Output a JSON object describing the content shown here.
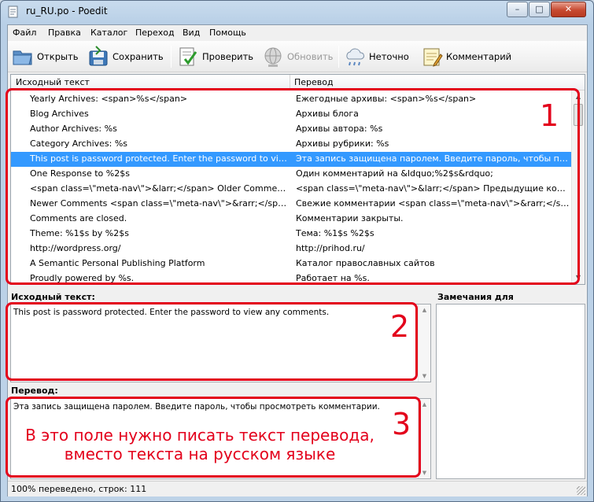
{
  "window": {
    "title": "ru_RU.po - Poedit",
    "minimize_label": "–",
    "maximize_label": "□",
    "close_label": "✕"
  },
  "menu": [
    "Файл",
    "Правка",
    "Каталог",
    "Переход",
    "Вид",
    "Помощь"
  ],
  "toolbar": {
    "open_label": "Открыть",
    "save_label": "Сохранить",
    "validate_label": "Проверить",
    "update_label": "Обновить",
    "fuzzy_label": "Неточно",
    "comment_label": "Комментарий"
  },
  "list": {
    "headers": {
      "source": "Исходный текст",
      "translation": "Перевод"
    },
    "rows": [
      {
        "source": "Yearly Archives: <span>%s</span>",
        "translation": "Ежегодные архивы: <span>%s</span>"
      },
      {
        "source": "Blog Archives",
        "translation": "Архивы блога"
      },
      {
        "source": "Author Archives: %s",
        "translation": "Архивы автора: %s"
      },
      {
        "source": "Category Archives: %s",
        "translation": "Архивы рубрики: %s"
      },
      {
        "source": "This post is password protected. Enter the password to view ...",
        "translation": "Эта запись защищена паролем. Введите пароль, чтобы про...",
        "selected": true
      },
      {
        "source": "One Response to %2$s",
        "translation": "Один комментарий на &ldquo;%2$s&rdquo;"
      },
      {
        "source": "<span class=\\\"meta-nav\\\">&larr;</span> Older Comments",
        "translation": "<span class=\\\"meta-nav\\\">&larr;</span> Предыдущие коммент..."
      },
      {
        "source": "Newer Comments <span class=\\\"meta-nav\\\">&rarr;</span>",
        "translation": "Свежие комментарии <span class=\\\"meta-nav\\\">&rarr;</span>"
      },
      {
        "source": "Comments are closed.",
        "translation": "Комментарии закрыты."
      },
      {
        "source": "Theme: %1$s by %2$s",
        "translation": "Тема: %1$s %2$s"
      },
      {
        "source": "http://wordpress.org/",
        "translation": "http://prihod.ru/"
      },
      {
        "source": "A Semantic Personal Publishing Platform",
        "translation": "Каталог православных сайтов"
      },
      {
        "source": "Proudly powered by %s.",
        "translation": "Работает на %s."
      }
    ]
  },
  "source_pane": {
    "label": "Исходный текст:",
    "text": "This post is password protected. Enter the password to view any comments."
  },
  "translation_pane": {
    "label": "Перевод:",
    "text": "Эта запись защищена паролем. Введите пароль, чтобы просмотреть комментарии."
  },
  "notes_pane": {
    "label": "Замечания для переводчиков:"
  },
  "status": {
    "text": "100% переведено, строк: 111"
  },
  "annotations": {
    "num1": "1",
    "num2": "2",
    "num3": "3",
    "hint_line1": "В это поле нужно писать текст перевода,",
    "hint_line2": "вместо текста на русском языке"
  },
  "colors": {
    "annotation": "#e3001b",
    "selection": "#3399ff"
  }
}
